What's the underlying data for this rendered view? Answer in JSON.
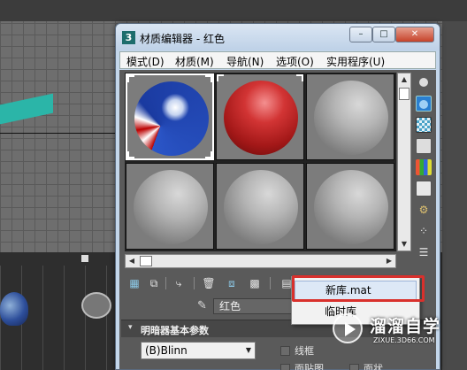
{
  "window": {
    "app_icon": "3",
    "title": "材质编辑器 - 红色",
    "controls": {
      "minimize": "–",
      "maximize": "□",
      "close": "✕"
    }
  },
  "menubar": {
    "items": [
      {
        "label": "模式(D)"
      },
      {
        "label": "材质(M)"
      },
      {
        "label": "导航(N)"
      },
      {
        "label": "选项(O)"
      },
      {
        "label": "实用程序(U)"
      }
    ]
  },
  "sample_slots": [
    {
      "material": "beach-ball",
      "active": true
    },
    {
      "material": "red",
      "active": false
    },
    {
      "material": "default-gray",
      "active": false
    },
    {
      "material": "default-gray",
      "active": false
    },
    {
      "material": "default-gray",
      "active": false
    },
    {
      "material": "default-gray",
      "active": false
    }
  ],
  "side_toolbar": {
    "icons": [
      "sample-type-icon",
      "backlight-icon",
      "background-icon",
      "sample-uv-tiling-icon",
      "video-color-check-icon",
      "make-preview-icon",
      "options-icon",
      "select-by-material-icon",
      "material-map-navigator-icon"
    ]
  },
  "bottom_toolbar": {
    "icons": [
      "get-material-icon",
      "put-to-scene-icon",
      "assign-to-selection-icon",
      "reset-map-icon",
      "make-copy-icon",
      "make-unique-icon",
      "put-to-library-icon"
    ]
  },
  "material": {
    "name": "红色"
  },
  "rollout": {
    "toggle": "▾",
    "title": "明暗器基本参数",
    "shader": "(B)Blinn",
    "checkboxes": {
      "wire": "线框",
      "face_map": "面贴图",
      "faceted": "面状"
    }
  },
  "popup_menu": {
    "items": [
      {
        "label": "新库.mat",
        "highlighted": true
      },
      {
        "label": "临时库",
        "highlighted": false
      }
    ]
  },
  "watermark": {
    "title": "溜溜自学",
    "url": "ZIXUE.3D66.COM"
  },
  "colors": {
    "highlight_box": "#d9302c",
    "viewport_teal": "#2bb5a8",
    "red_material": "#c62828"
  }
}
